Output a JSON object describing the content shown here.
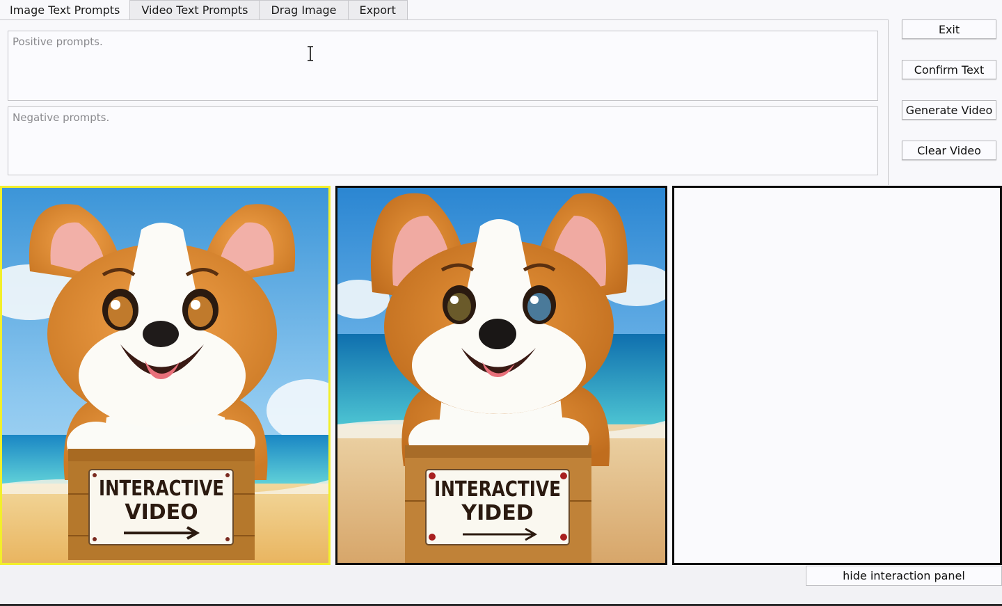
{
  "tabs": [
    {
      "label": "Image Text Prompts",
      "active": true
    },
    {
      "label": "Video Text Prompts",
      "active": false
    },
    {
      "label": "Drag Image",
      "active": false
    },
    {
      "label": "Export",
      "active": false
    }
  ],
  "prompts": {
    "positive_placeholder": "Positive prompts.",
    "positive_value": "",
    "negative_placeholder": "Negative prompts.",
    "negative_value": ""
  },
  "side_buttons": {
    "exit": "Exit",
    "confirm_text": "Confirm Text",
    "generate_video": "Generate Video",
    "clear_video": "Clear Video"
  },
  "frames": [
    {
      "sign_line1": "INTERACTIVE",
      "sign_line2": "VIDEO",
      "selected": true,
      "border_color": "#f2ef2a"
    },
    {
      "sign_line1": "INTERACTIVE",
      "sign_line2": "YIDED",
      "selected": false,
      "border_color": "#0c0c0c"
    },
    {
      "empty": true,
      "border_color": "#0c0c0c"
    }
  ],
  "footer": {
    "hide_panel_label": "hide interaction panel"
  },
  "icons": {
    "text_cursor": "i-beam-cursor-icon",
    "sign_arrow": "right-arrow-icon"
  }
}
